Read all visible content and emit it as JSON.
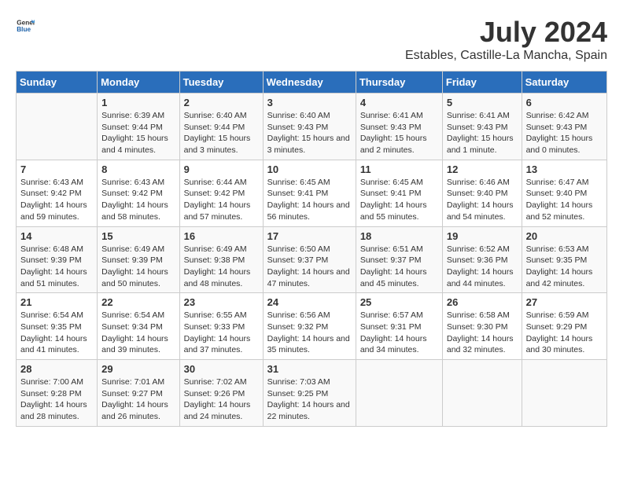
{
  "logo": {
    "general": "General",
    "blue": "Blue"
  },
  "title": "July 2024",
  "subtitle": "Estables, Castille-La Mancha, Spain",
  "days_of_week": [
    "Sunday",
    "Monday",
    "Tuesday",
    "Wednesday",
    "Thursday",
    "Friday",
    "Saturday"
  ],
  "weeks": [
    [
      null,
      {
        "day": "1",
        "sunrise": "6:39 AM",
        "sunset": "9:44 PM",
        "daylight": "15 hours and 4 minutes."
      },
      {
        "day": "2",
        "sunrise": "6:40 AM",
        "sunset": "9:44 PM",
        "daylight": "15 hours and 3 minutes."
      },
      {
        "day": "3",
        "sunrise": "6:40 AM",
        "sunset": "9:43 PM",
        "daylight": "15 hours and 3 minutes."
      },
      {
        "day": "4",
        "sunrise": "6:41 AM",
        "sunset": "9:43 PM",
        "daylight": "15 hours and 2 minutes."
      },
      {
        "day": "5",
        "sunrise": "6:41 AM",
        "sunset": "9:43 PM",
        "daylight": "15 hours and 1 minute."
      },
      {
        "day": "6",
        "sunrise": "6:42 AM",
        "sunset": "9:43 PM",
        "daylight": "15 hours and 0 minutes."
      }
    ],
    [
      {
        "day": "7",
        "sunrise": "6:43 AM",
        "sunset": "9:42 PM",
        "daylight": "14 hours and 59 minutes."
      },
      {
        "day": "8",
        "sunrise": "6:43 AM",
        "sunset": "9:42 PM",
        "daylight": "14 hours and 58 minutes."
      },
      {
        "day": "9",
        "sunrise": "6:44 AM",
        "sunset": "9:42 PM",
        "daylight": "14 hours and 57 minutes."
      },
      {
        "day": "10",
        "sunrise": "6:45 AM",
        "sunset": "9:41 PM",
        "daylight": "14 hours and 56 minutes."
      },
      {
        "day": "11",
        "sunrise": "6:45 AM",
        "sunset": "9:41 PM",
        "daylight": "14 hours and 55 minutes."
      },
      {
        "day": "12",
        "sunrise": "6:46 AM",
        "sunset": "9:40 PM",
        "daylight": "14 hours and 54 minutes."
      },
      {
        "day": "13",
        "sunrise": "6:47 AM",
        "sunset": "9:40 PM",
        "daylight": "14 hours and 52 minutes."
      }
    ],
    [
      {
        "day": "14",
        "sunrise": "6:48 AM",
        "sunset": "9:39 PM",
        "daylight": "14 hours and 51 minutes."
      },
      {
        "day": "15",
        "sunrise": "6:49 AM",
        "sunset": "9:39 PM",
        "daylight": "14 hours and 50 minutes."
      },
      {
        "day": "16",
        "sunrise": "6:49 AM",
        "sunset": "9:38 PM",
        "daylight": "14 hours and 48 minutes."
      },
      {
        "day": "17",
        "sunrise": "6:50 AM",
        "sunset": "9:37 PM",
        "daylight": "14 hours and 47 minutes."
      },
      {
        "day": "18",
        "sunrise": "6:51 AM",
        "sunset": "9:37 PM",
        "daylight": "14 hours and 45 minutes."
      },
      {
        "day": "19",
        "sunrise": "6:52 AM",
        "sunset": "9:36 PM",
        "daylight": "14 hours and 44 minutes."
      },
      {
        "day": "20",
        "sunrise": "6:53 AM",
        "sunset": "9:35 PM",
        "daylight": "14 hours and 42 minutes."
      }
    ],
    [
      {
        "day": "21",
        "sunrise": "6:54 AM",
        "sunset": "9:35 PM",
        "daylight": "14 hours and 41 minutes."
      },
      {
        "day": "22",
        "sunrise": "6:54 AM",
        "sunset": "9:34 PM",
        "daylight": "14 hours and 39 minutes."
      },
      {
        "day": "23",
        "sunrise": "6:55 AM",
        "sunset": "9:33 PM",
        "daylight": "14 hours and 37 minutes."
      },
      {
        "day": "24",
        "sunrise": "6:56 AM",
        "sunset": "9:32 PM",
        "daylight": "14 hours and 35 minutes."
      },
      {
        "day": "25",
        "sunrise": "6:57 AM",
        "sunset": "9:31 PM",
        "daylight": "14 hours and 34 minutes."
      },
      {
        "day": "26",
        "sunrise": "6:58 AM",
        "sunset": "9:30 PM",
        "daylight": "14 hours and 32 minutes."
      },
      {
        "day": "27",
        "sunrise": "6:59 AM",
        "sunset": "9:29 PM",
        "daylight": "14 hours and 30 minutes."
      }
    ],
    [
      {
        "day": "28",
        "sunrise": "7:00 AM",
        "sunset": "9:28 PM",
        "daylight": "14 hours and 28 minutes."
      },
      {
        "day": "29",
        "sunrise": "7:01 AM",
        "sunset": "9:27 PM",
        "daylight": "14 hours and 26 minutes."
      },
      {
        "day": "30",
        "sunrise": "7:02 AM",
        "sunset": "9:26 PM",
        "daylight": "14 hours and 24 minutes."
      },
      {
        "day": "31",
        "sunrise": "7:03 AM",
        "sunset": "9:25 PM",
        "daylight": "14 hours and 22 minutes."
      },
      null,
      null,
      null
    ]
  ]
}
